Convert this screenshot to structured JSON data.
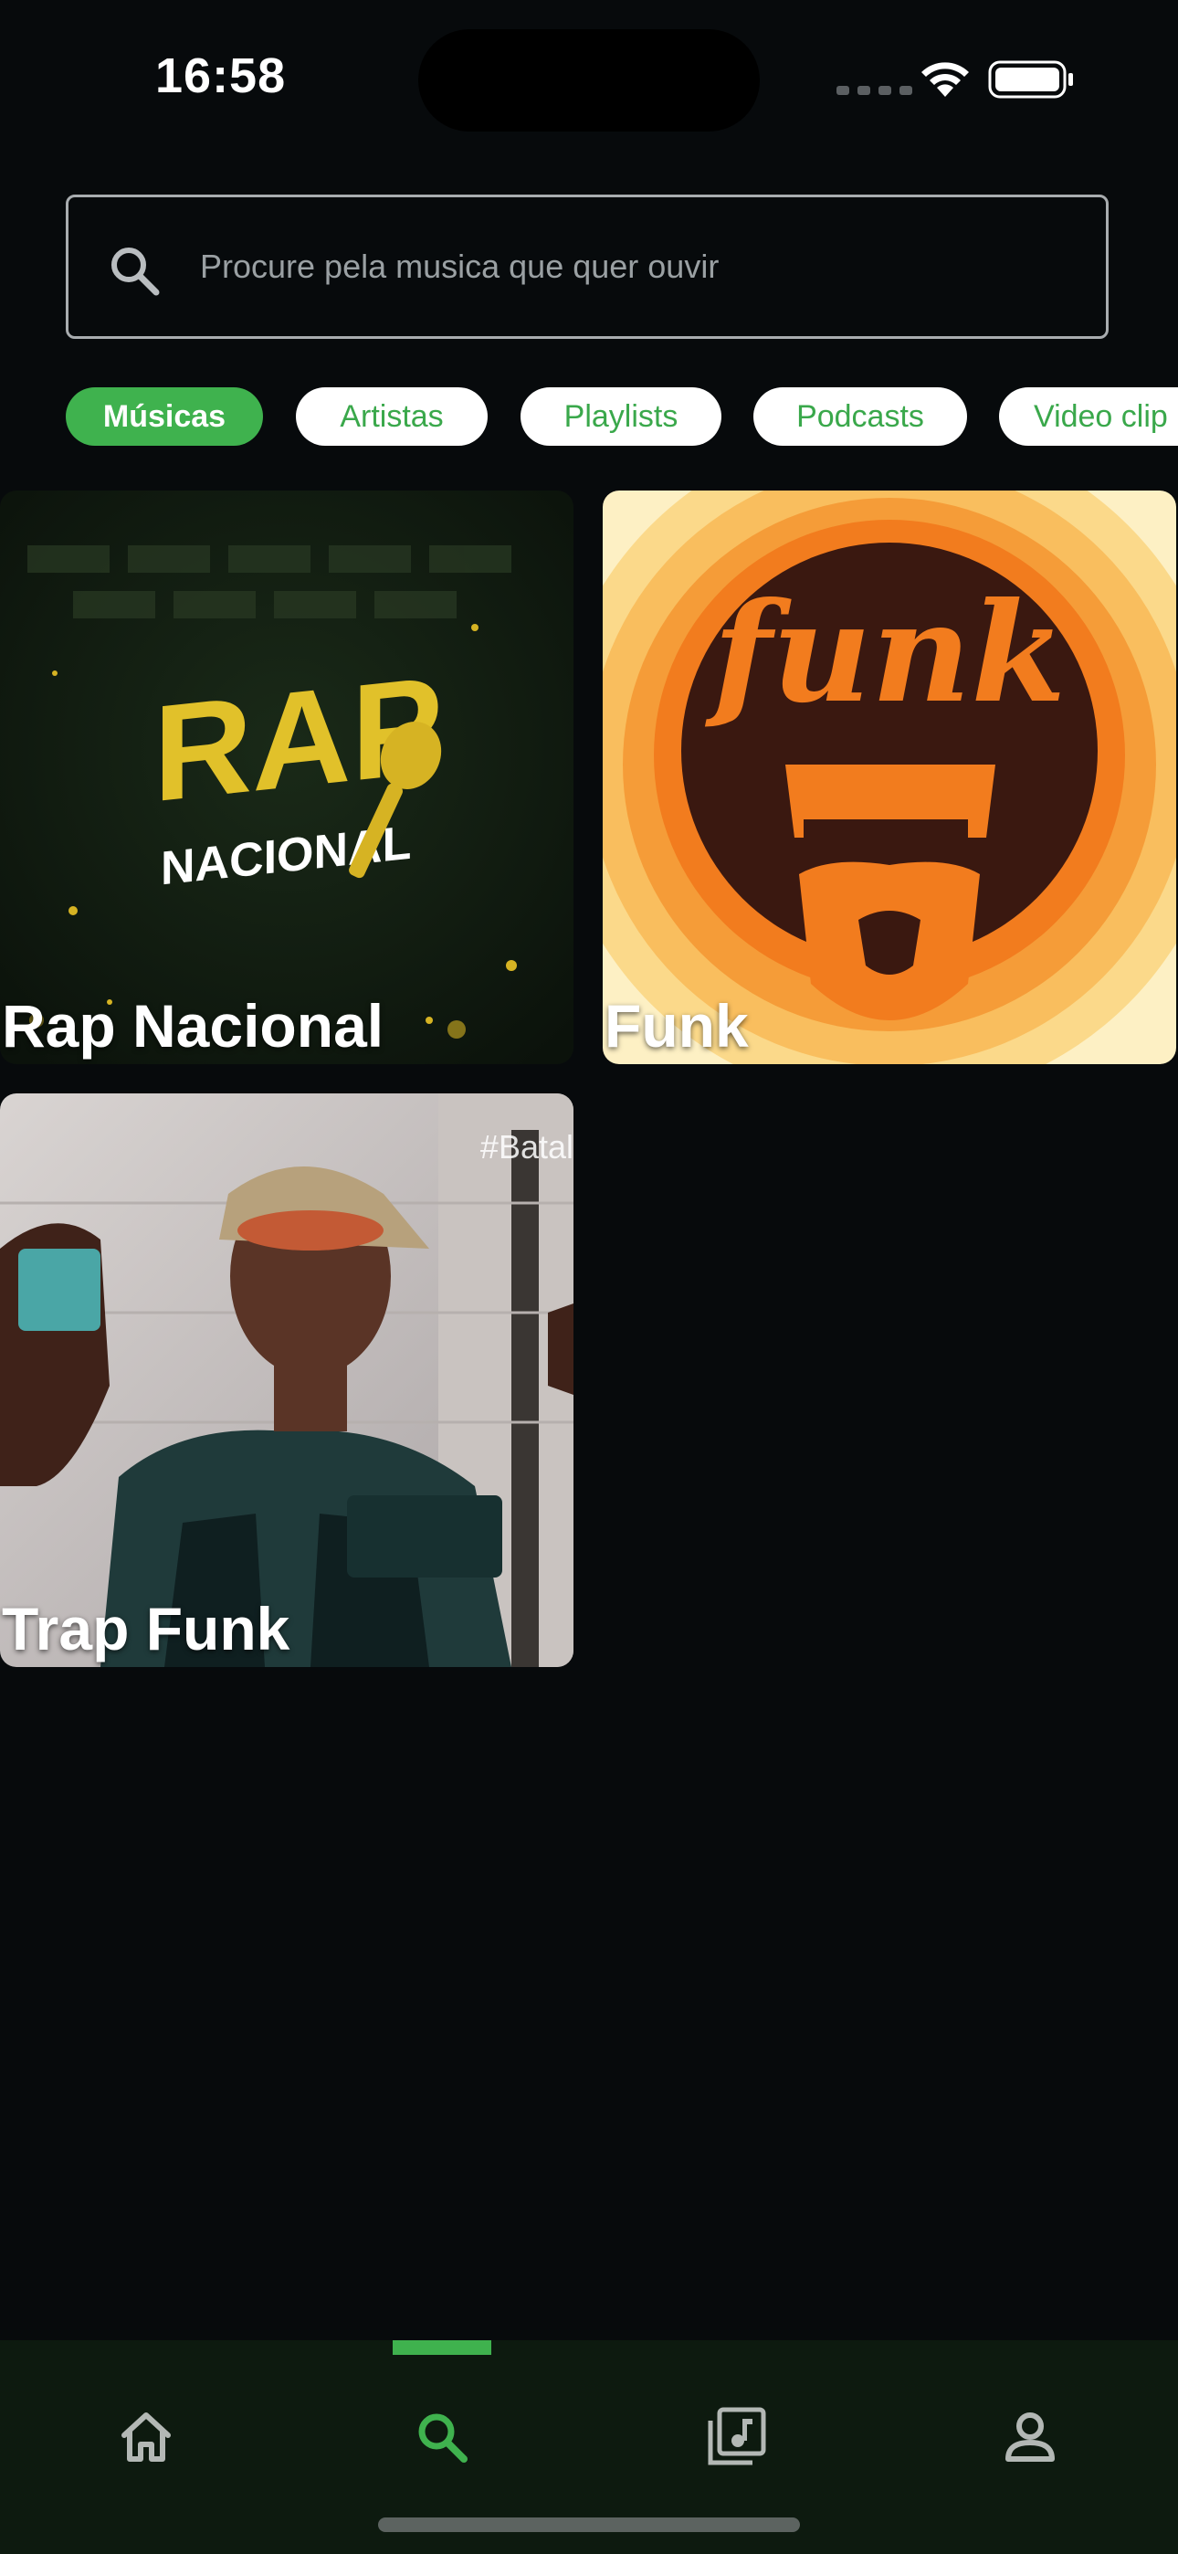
{
  "status_bar": {
    "time": "16:58"
  },
  "search": {
    "placeholder": "Procure pela musica que quer ouvir",
    "icon": "search-icon"
  },
  "filters": [
    {
      "label": "Músicas",
      "active": true
    },
    {
      "label": "Artistas",
      "active": false
    },
    {
      "label": "Playlists",
      "active": false
    },
    {
      "label": "Podcasts",
      "active": false
    },
    {
      "label": "Video clip",
      "active": false
    }
  ],
  "cards": [
    {
      "title": "Rap Nacional",
      "art_text_1": "RAP",
      "art_text_2": "NACIONAL"
    },
    {
      "title": "Funk",
      "art_text": "funk"
    },
    {
      "title": "Trap Funk",
      "tag": "#Batal"
    }
  ],
  "bottom_nav": {
    "items": [
      {
        "name": "home",
        "icon": "home-icon",
        "active": false
      },
      {
        "name": "search",
        "icon": "search-icon",
        "active": true
      },
      {
        "name": "library",
        "icon": "music-library-icon",
        "active": false
      },
      {
        "name": "profile",
        "icon": "person-icon",
        "active": false
      }
    ]
  },
  "colors": {
    "background": "#070a0c",
    "accent": "#3fb24e",
    "nav_background": "#0d1a0f"
  }
}
